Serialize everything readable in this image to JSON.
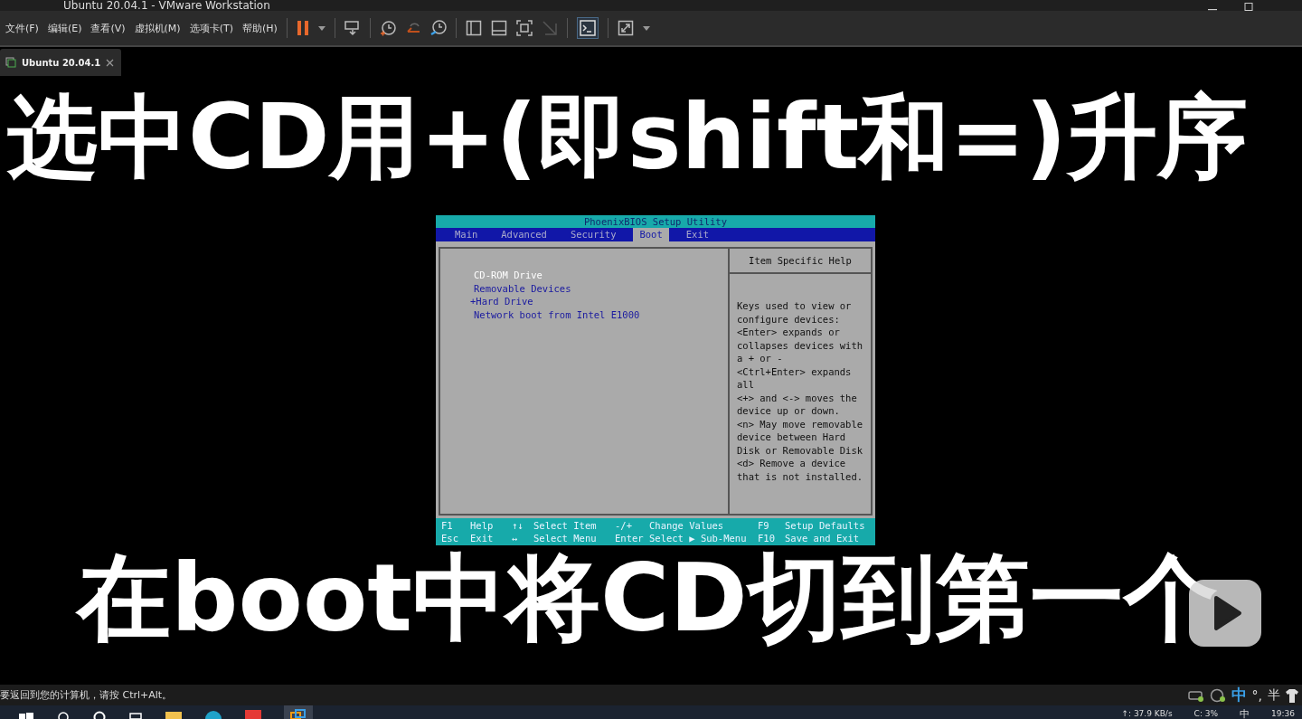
{
  "window": {
    "title": "Ubuntu 20.04.1 - VMware Workstation"
  },
  "menu": [
    "文件(F)",
    "编辑(E)",
    "查看(V)",
    "虚拟机(M)",
    "选项卡(T)",
    "帮助(H)"
  ],
  "vm_tabs": [
    {
      "label": "Ubuntu 20.04.1",
      "selected": true
    }
  ],
  "bios": {
    "title": "PhoenixBIOS Setup Utility",
    "tabs": [
      {
        "label": "Main",
        "selected": false
      },
      {
        "label": "Advanced",
        "selected": false
      },
      {
        "label": "Security",
        "selected": false
      },
      {
        "label": "Boot",
        "selected": true
      },
      {
        "label": "Exit",
        "selected": false
      }
    ],
    "boot_items": [
      {
        "label": "CD-ROM Drive",
        "selected": true
      },
      {
        "label": "Removable Devices",
        "selected": false
      },
      {
        "label": "+Hard Drive",
        "selected": false
      },
      {
        "label": "Network boot from Intel E1000",
        "selected": false
      }
    ],
    "help_title": "Item Specific Help",
    "help_lines": [
      "Keys used to view or",
      "configure devices:",
      "<Enter> expands or",
      "collapses devices with",
      "a + or -",
      "<Ctrl+Enter> expands",
      "all",
      "<+> and <-> moves the",
      "device up or down.",
      "<n> May move removable",
      "device between Hard",
      "Disk or Removable Disk",
      "<d> Remove a device",
      "that is not installed."
    ],
    "footer": [
      [
        {
          "key": "F1",
          "action": "Help"
        },
        {
          "key": "↑↓",
          "action": "Select Item"
        },
        {
          "key": "-/+",
          "action": "Change Values"
        },
        {
          "key": "F9",
          "action": "Setup Defaults"
        }
      ],
      [
        {
          "key": "Esc",
          "action": "Exit"
        },
        {
          "key": "↔",
          "action": "Select Menu"
        },
        {
          "key": "Enter",
          "action": "Select ▶ Sub-Menu"
        },
        {
          "key": "F10",
          "action": "Save and Exit"
        }
      ]
    ]
  },
  "captions": {
    "top": "选中CD用+(即shift和=)升序",
    "bottom": "在boot中将CD切到第一个"
  },
  "status_bar": {
    "message": "要返回到您的计算机，请按 Ctrl+Alt。",
    "ime": "中",
    "punctuation": "°,",
    "width_mode": "半"
  },
  "taskbar": {
    "network": "↑: 37.9 KB/s",
    "cpu": "C: 3%",
    "ime": "中",
    "time": "19:36"
  }
}
